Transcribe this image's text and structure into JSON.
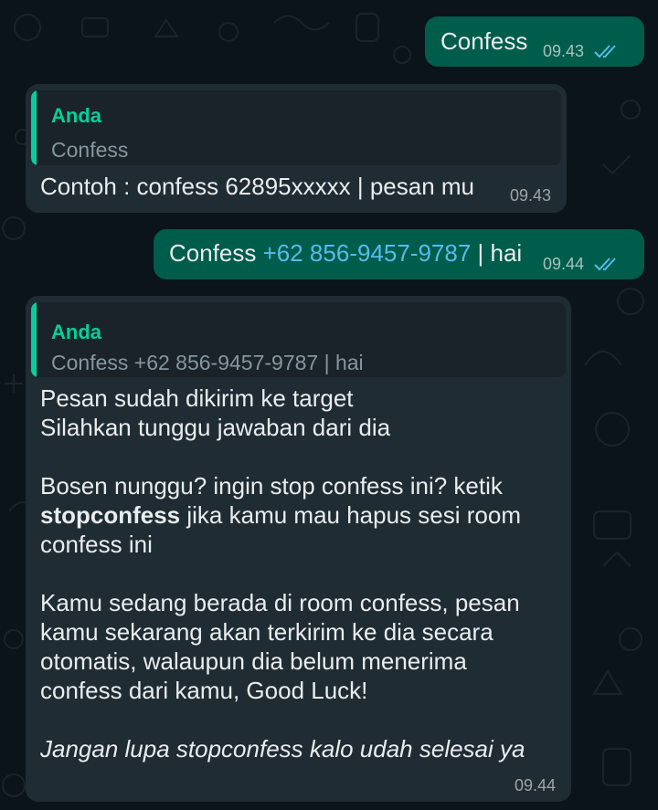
{
  "messages": [
    {
      "id": "m1",
      "direction": "outgoing",
      "text": "Confess",
      "time": "09.43",
      "status": "read"
    },
    {
      "id": "m2",
      "direction": "incoming",
      "quote": {
        "author": "Anda",
        "text": "Confess"
      },
      "text": "Contoh : confess 62895xxxxx | pesan mu",
      "time": "09.43"
    },
    {
      "id": "m3",
      "direction": "outgoing",
      "text_prefix": "Confess ",
      "link": "+62 856-9457-9787",
      "text_suffix": " | hai",
      "time": "09.44",
      "status": "read"
    },
    {
      "id": "m4",
      "direction": "incoming",
      "quote": {
        "author": "Anda",
        "text": "Confess +62 856-9457-9787 | hai"
      },
      "lines": {
        "l1": "Pesan sudah dikirim ke target",
        "l2": "Silahkan tunggu jawaban dari dia",
        "l3": "Bosen nunggu? ingin stop confess ini? ketik",
        "l4_bold": "stopconfess",
        "l4_rest": " jika kamu mau hapus sesi room",
        "l5": "confess ini",
        "l6": "Kamu sedang berada di room confess, pesan",
        "l7": "kamu sekarang akan terkirim ke dia secara",
        "l8": "otomatis, walaupun dia belum menerima",
        "l9": "confess dari kamu, Good Luck!",
        "l10_italic": "Jangan lupa stopconfess kalo udah selesai ya"
      },
      "time": "09.44"
    }
  ],
  "colors": {
    "background": "#0b141a",
    "outgoing_bubble": "#005c4b",
    "incoming_bubble": "#202c33",
    "quote_accent": "#06cf9c",
    "link": "#53bdeb",
    "read_ticks": "#53bdeb"
  },
  "icons": {
    "read_receipt": "double-check-icon"
  }
}
